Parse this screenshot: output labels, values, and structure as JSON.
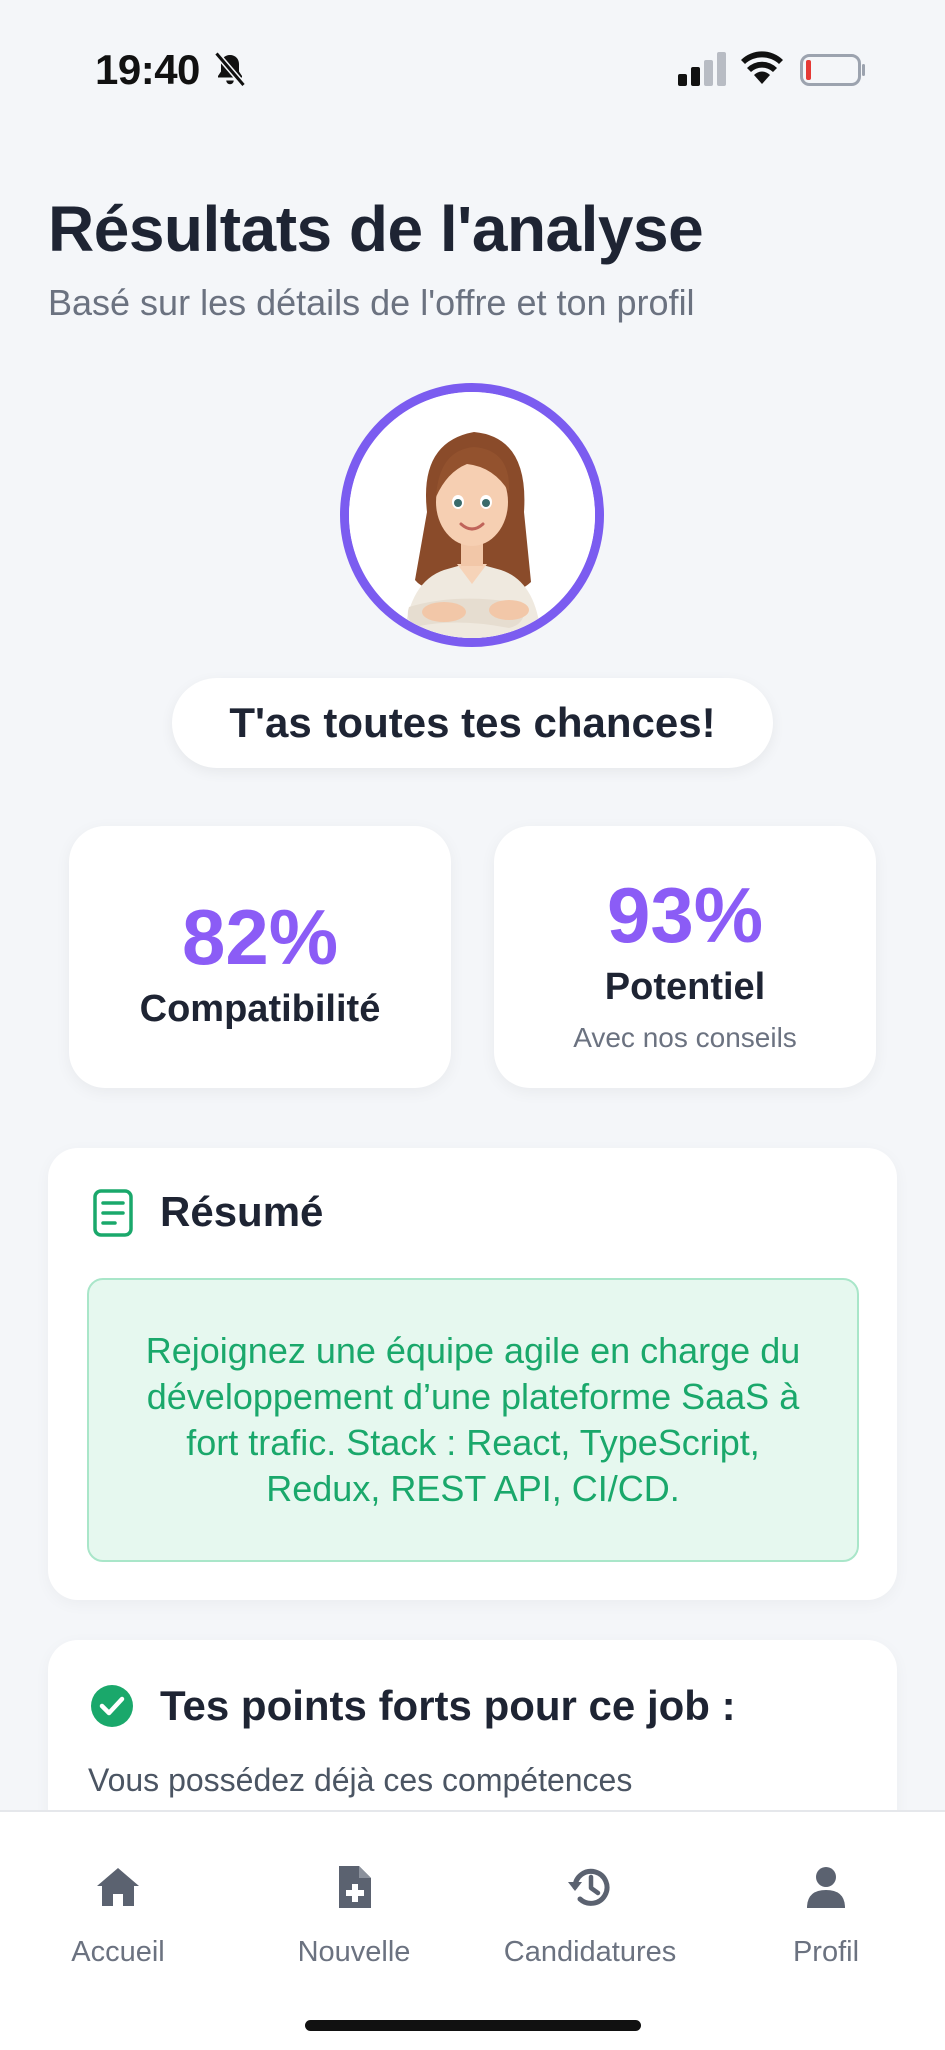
{
  "status_bar": {
    "time": "19:40",
    "icons": [
      "bell-off-icon",
      "cellular-signal-icon",
      "wifi-icon",
      "battery-low-icon"
    ]
  },
  "header": {
    "title": "Résultats de l'analyse",
    "subtitle": "Basé sur les détails de l'offre et ton profil"
  },
  "avatar": {
    "icon": "avatar-illustration",
    "ring_color": "#7b5cf0"
  },
  "chances": {
    "label": "T'as toutes tes chances!"
  },
  "stats": {
    "compatibility": {
      "value": "82%",
      "label": "Compatibilité"
    },
    "potential": {
      "value": "93%",
      "label": "Potentiel",
      "note": "Avec nos conseils"
    },
    "accent_color": "#8b5cf6"
  },
  "summary": {
    "icon": "document-icon",
    "title": "Résumé",
    "text": "Rejoignez une équipe agile en charge du développement d’une plateforme SaaS à fort trafic. Stack : React, TypeScript, Redux, REST API, CI/CD.",
    "text_color": "#1aa86b",
    "box_color": "#e6f8ef"
  },
  "strengths": {
    "icon": "check-circle-icon",
    "title": "Tes points forts pour ce job :",
    "text": "Vous possédez déjà ces compétences"
  },
  "bottom_nav": {
    "items": [
      {
        "label": "Accueil",
        "icon": "home-icon"
      },
      {
        "label": "Nouvelle",
        "icon": "new-document-icon"
      },
      {
        "label": "Candidatures",
        "icon": "history-icon"
      },
      {
        "label": "Profil",
        "icon": "user-icon"
      }
    ]
  }
}
